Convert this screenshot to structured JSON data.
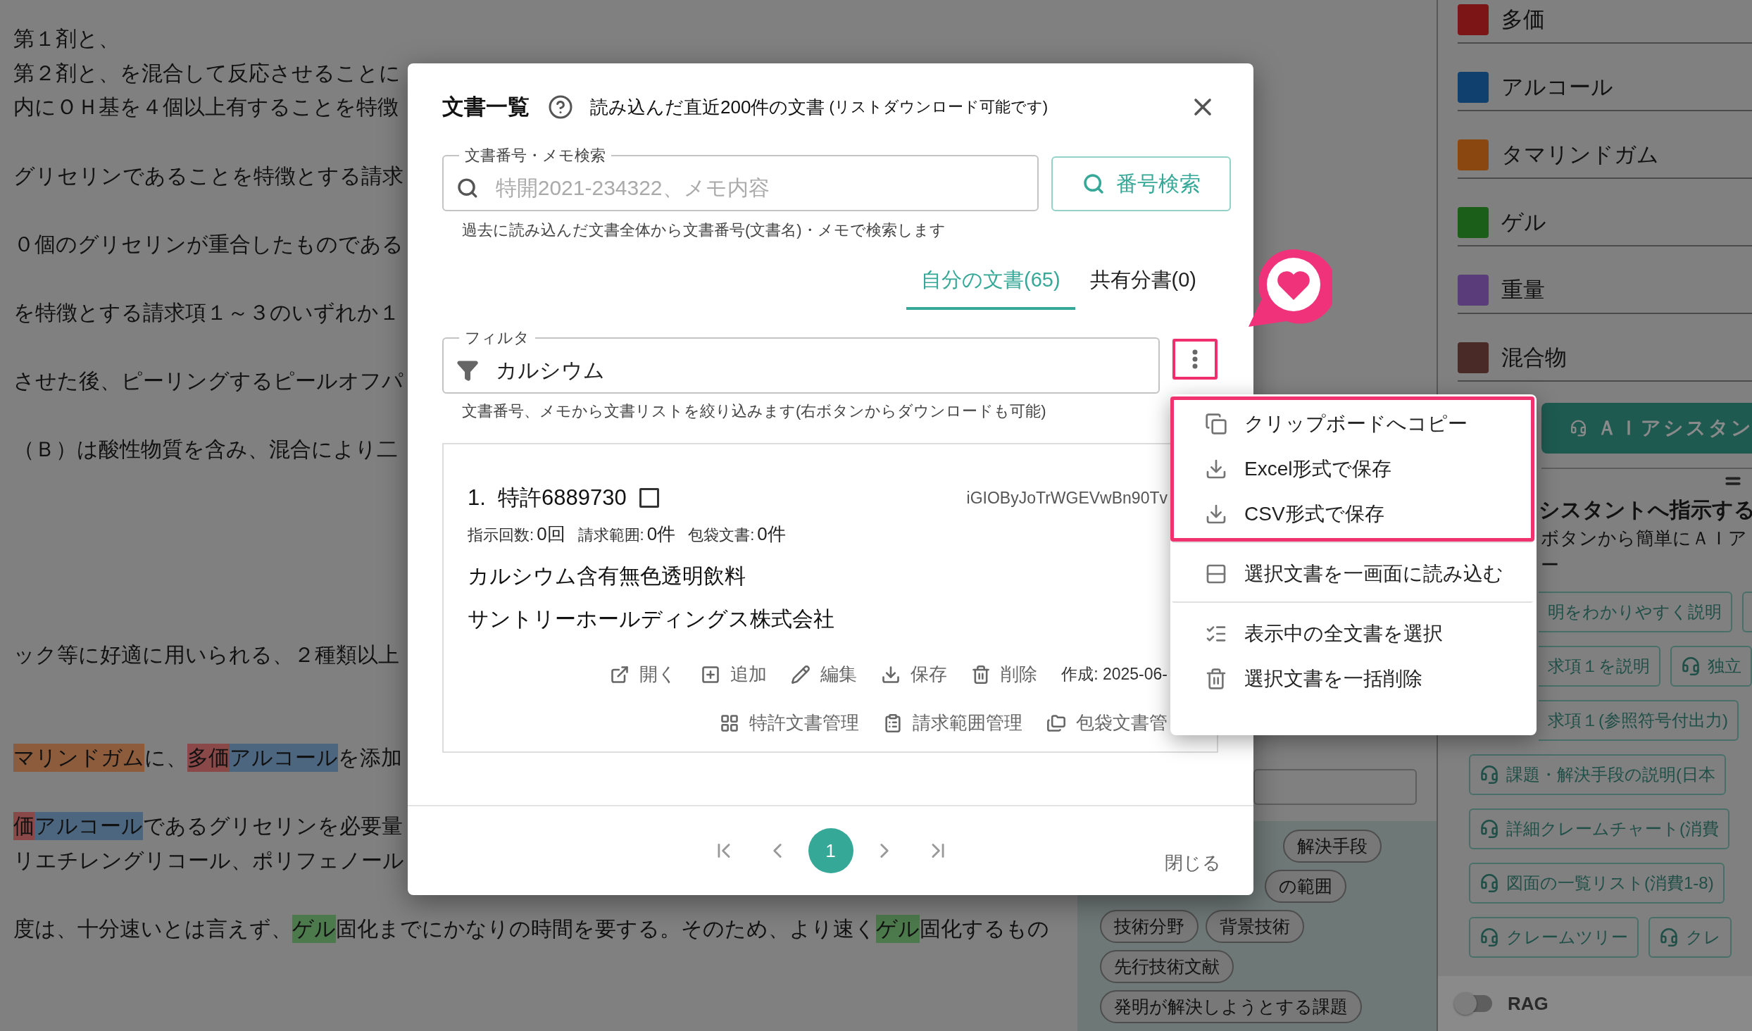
{
  "document": {
    "paragraphs": [
      {
        "lines": [
          [
            {
              "text": "第１剤と、"
            }
          ],
          [
            {
              "text": "第２剤と、を混合して反応させることに"
            }
          ],
          [
            {
              "text": "内にＯＨ基を４個以上有することを特徴"
            }
          ]
        ]
      },
      {
        "lines": [
          [
            {
              "text": "グリセリンであることを特徴とする請求"
            }
          ]
        ]
      },
      {
        "lines": [
          [
            {
              "text": "０個のグリセリンが重合したものである"
            }
          ]
        ]
      },
      {
        "lines": [
          [
            {
              "text": "を特徴とする請求項１～３のいずれか１"
            }
          ]
        ]
      },
      {
        "lines": [
          [
            {
              "text": "させた後、ピーリングするピールオフパ"
            }
          ]
        ]
      },
      {
        "lines": [
          [
            {
              "text": "（Ｂ）は酸性物質を含み、混合により二"
            }
          ]
        ]
      },
      {
        "lines": [
          [
            {
              "text": "ック等に好適に用いられる、２種類以上"
            }
          ]
        ]
      },
      {
        "lines": [
          [
            {
              "text": "マリンドガム",
              "color": "#8c5c3c"
            },
            {
              "text": "に、"
            },
            {
              "text": "多価",
              "color": "#8a4848"
            },
            {
              "text": "アルコール",
              "color": "#4c6680"
            },
            {
              "text": "を添加"
            }
          ]
        ]
      },
      {
        "lines": [
          [
            {
              "text": "価",
              "color": "#8a4848"
            },
            {
              "text": "アルコール",
              "color": "#4c6680"
            },
            {
              "text": "であるグリセリンを必要量"
            }
          ],
          [
            {
              "text": "リエチレングリコール、ポリフェノール"
            }
          ]
        ]
      },
      {
        "lines": [
          [
            {
              "text": "度は、十分速いとは言えず、"
            },
            {
              "text": "ゲル",
              "color": "#4d7a4d"
            },
            {
              "text": "固化までにかなりの時間を要する。そのため、より速く"
            },
            {
              "text": "ゲル",
              "color": "#4d7a4d"
            },
            {
              "text": "固化するもの"
            }
          ]
        ]
      }
    ]
  },
  "middle": {
    "tag_rows": [
      [
        "解決手段"
      ],
      [
        "の範囲"
      ],
      [
        "技術分野",
        "背景技術"
      ],
      [
        "先行技術文献"
      ],
      [
        "発明が解決しようとする課題"
      ]
    ]
  },
  "legend": [
    {
      "label": "多価",
      "color": "#7c1616"
    },
    {
      "label": "アルコール",
      "color": "#10416e"
    },
    {
      "label": "タマリンドガム",
      "color": "#8a4810"
    },
    {
      "label": "ゲル",
      "color": "#1a5e1a"
    },
    {
      "label": "重量",
      "color": "#5a3c7a"
    },
    {
      "label": "混合物",
      "color": "#4a2a26"
    }
  ],
  "assistant": {
    "button": "ＡＩアシスタン",
    "heading": "シスタントへ指示する",
    "description": [
      "ボタンから簡単にＡＩア",
      "ー"
    ],
    "prompt_rows": [
      [
        {
          "label": "明をわかりやすく説明",
          "kind": "partial"
        },
        {
          "kind": "stub"
        }
      ],
      [
        {
          "label": "求項１を説明",
          "kind": "partial"
        },
        {
          "label": "独立",
          "kind": "full"
        }
      ],
      [
        {
          "label": "求項１(参照符号付出力)",
          "kind": "partial"
        }
      ],
      [
        {
          "label": "課題・解決手段の説明(日本",
          "kind": "full"
        }
      ],
      [
        {
          "label": "詳細クレームチャート(消費",
          "kind": "full"
        }
      ],
      [
        {
          "label": "図面の一覧リスト(消費1-8)",
          "kind": "full"
        }
      ],
      [
        {
          "label": "クレームツリー",
          "kind": "full"
        },
        {
          "label": "クレ",
          "kind": "full"
        }
      ]
    ]
  },
  "rag": {
    "label": "RAG",
    "on": false
  },
  "dialog": {
    "title": "文書一覧",
    "subtitle": "読み込んだ直近200件の文書",
    "subtitle_note": "(リストダウンロード可能です)",
    "search": {
      "label": "文書番号・メモ検索",
      "placeholder": "特開2021-234322、メモ内容",
      "button": "番号検索",
      "helper": "過去に読み込んだ文書全体から文書番号(文書名)・メモで検索します"
    },
    "tabs": [
      {
        "label": "自分の文書(65)",
        "selected": true
      },
      {
        "label": "共有分書(0)",
        "selected": false
      }
    ],
    "filter": {
      "label": "フィルタ",
      "value": "カルシウム",
      "helper": "文書番号、メモから文書リストを絞り込みます(右ボタンからダウンロードも可能)",
      "more_highlighted": true
    },
    "documents": [
      {
        "number": "1.",
        "title": "特許6889730",
        "checked": false,
        "id": "iGIOByJoTrWGEVwBn90Tv",
        "stats": [
          {
            "label": "指示回数:",
            "value": "0回"
          },
          {
            "label": "請求範囲:",
            "value": "0件"
          },
          {
            "label": "包袋文書:",
            "value": "0件"
          }
        ],
        "name": "カルシウム含有無色透明飲料",
        "company": "サントリーホールディングス株式会社",
        "actions": [
          {
            "label": "開く",
            "kind": "open"
          },
          {
            "label": "追加",
            "kind": "add"
          },
          {
            "label": "編集",
            "kind": "edit"
          },
          {
            "label": "保存",
            "kind": "save"
          },
          {
            "label": "削除",
            "kind": "delete"
          }
        ],
        "created": "作成: 2025-06-",
        "management": [
          {
            "label": "特許文書管理",
            "kind": "grid"
          },
          {
            "label": "請求範囲管理",
            "kind": "clipboard"
          },
          {
            "label": "包袋文書管",
            "kind": "folder"
          }
        ]
      }
    ],
    "pages": [
      {
        "label": "1",
        "selected": true
      }
    ],
    "close": "閉じる"
  },
  "menu": {
    "groups": [
      {
        "highlighted": true,
        "items": [
          {
            "label": "クリップボードへコピー",
            "kind": "copy"
          },
          {
            "label": "Excel形式で保存",
            "kind": "download"
          },
          {
            "label": "CSV形式で保存",
            "kind": "download"
          }
        ]
      },
      {
        "highlighted": false,
        "items": [
          {
            "label": "選択文書を一画面に読み込む",
            "kind": "rows"
          }
        ]
      },
      {
        "highlighted": false,
        "items": [
          {
            "label": "表示中の全文書を選択",
            "kind": "select-all"
          },
          {
            "label": "選択文書を一括削除",
            "kind": "delete"
          }
        ]
      }
    ]
  }
}
